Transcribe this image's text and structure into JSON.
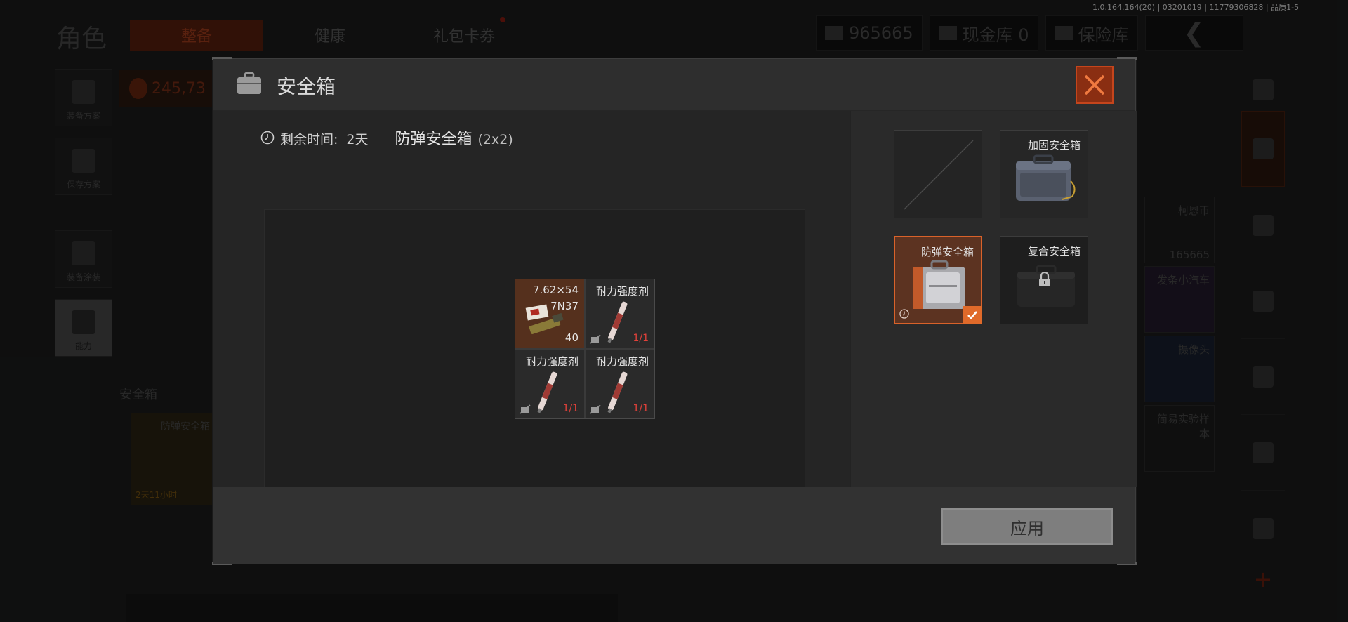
{
  "version": "1.0.164.164(20) | 03201019 | 11779306828 | 品质1-5",
  "background": {
    "page_title": "角色",
    "tabs": [
      {
        "label": "整备",
        "active": true
      },
      {
        "label": "健康",
        "active": false
      },
      {
        "label": "礼包卡券",
        "active": false
      }
    ],
    "stats": {
      "currency": "965665",
      "cash_vault": "现金库 0",
      "insurance_vault": "保险库"
    },
    "left_buttons": [
      "装备方案",
      "保存方案",
      "装备涂装",
      "能力"
    ],
    "money": "245,73",
    "safe_label": "安全箱",
    "safe_card": {
      "name": "防弹安全箱",
      "timer": "2天11小时"
    },
    "grid_items": [
      "柯恩币",
      "165665",
      "发条小汽车",
      "摄像头",
      "简易实验样本"
    ]
  },
  "modal": {
    "title": "安全箱",
    "remain_label": "剩余时间:",
    "remain_value": "2天",
    "case_name": "防弹安全箱",
    "case_size": "(2x2)",
    "items": [
      {
        "name": "7.62×54",
        "name2": "7N37",
        "count": "40",
        "type": "ammo"
      },
      {
        "name": "耐力强度剂",
        "durability": "1/1",
        "type": "syringe"
      },
      {
        "name": "耐力强度剂",
        "durability": "1/1",
        "type": "syringe"
      },
      {
        "name": "耐力强度剂",
        "durability": "1/1",
        "type": "syringe"
      }
    ],
    "case_options": [
      {
        "name": "",
        "state": "empty"
      },
      {
        "name": "加固安全箱",
        "state": "available"
      },
      {
        "name": "防弹安全箱",
        "state": "selected"
      },
      {
        "name": "复合安全箱",
        "state": "locked"
      }
    ],
    "apply_label": "应用",
    "colors": {
      "accent": "#e06a2a",
      "close_bg": "#8a2e12",
      "durability": "#e2413a"
    }
  }
}
